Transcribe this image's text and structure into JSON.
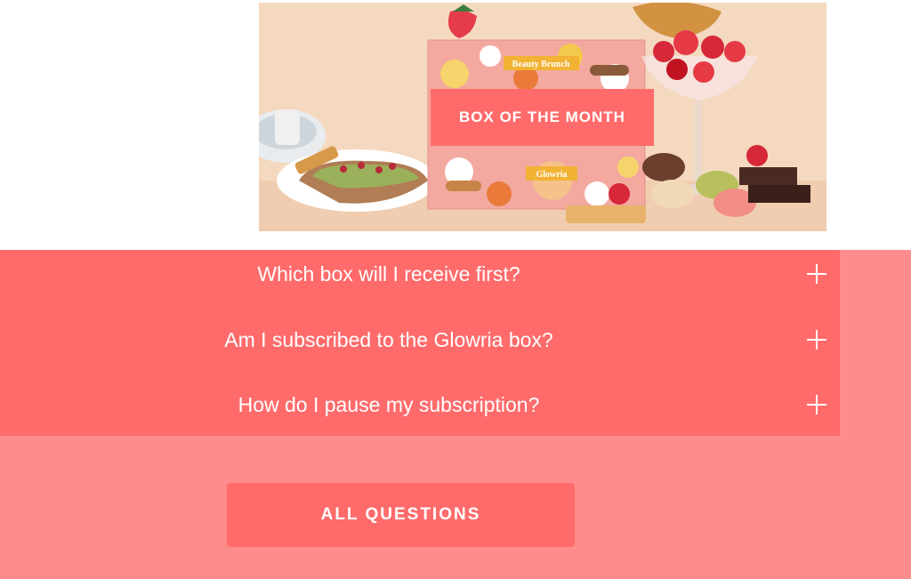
{
  "hero": {
    "badge_label": "BOX OF THE MONTH",
    "box_label_top": "Beauty Brunch",
    "box_label_bottom": "Glowria",
    "colors": {
      "badge": "#ff6b6b",
      "background": "#f3dcc6"
    }
  },
  "faq": {
    "items": [
      {
        "question": "Which box will I receive first?",
        "icon": "plus-icon"
      },
      {
        "question": "Am I subscribed to the Glowria box?",
        "icon": "plus-icon"
      },
      {
        "question": "How do I pause my subscription?",
        "icon": "plus-icon"
      }
    ],
    "colors": {
      "panel": "#ff6b6b",
      "section": "#ff8c8c"
    }
  },
  "cta": {
    "all_questions_label": "ALL QUESTIONS"
  }
}
